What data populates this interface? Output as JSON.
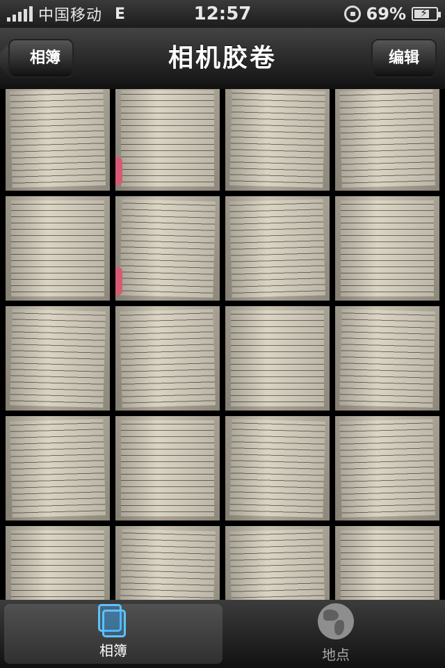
{
  "status_bar": {
    "carrier": "中国移动",
    "network": "E",
    "time": "12:57",
    "battery_percent": "69%",
    "battery_level": 0.69,
    "icons": [
      "signal-icon",
      "orientation-lock-icon",
      "battery-charging-icon"
    ]
  },
  "nav": {
    "title": "相机胶卷",
    "back_label": "相簿",
    "edit_label": "编辑"
  },
  "photos": [
    {
      "row": 0,
      "col": 0
    },
    {
      "row": 0,
      "col": 1
    },
    {
      "row": 0,
      "col": 2
    },
    {
      "row": 0,
      "col": 3
    },
    {
      "row": 1,
      "col": 0
    },
    {
      "row": 1,
      "col": 1
    },
    {
      "row": 1,
      "col": 2
    },
    {
      "row": 1,
      "col": 3
    },
    {
      "row": 2,
      "col": 0
    },
    {
      "row": 2,
      "col": 1
    },
    {
      "row": 2,
      "col": 2
    },
    {
      "row": 2,
      "col": 3
    },
    {
      "row": 3,
      "col": 0
    },
    {
      "row": 3,
      "col": 1
    },
    {
      "row": 3,
      "col": 2
    },
    {
      "row": 3,
      "col": 3
    },
    {
      "row": 4,
      "col": 0
    },
    {
      "row": 4,
      "col": 1
    },
    {
      "row": 4,
      "col": 2
    },
    {
      "row": 4,
      "col": 3
    }
  ],
  "tabs": [
    {
      "label": "相簿",
      "icon": "albums-icon",
      "active": true
    },
    {
      "label": "地点",
      "icon": "globe-icon",
      "active": false
    }
  ]
}
